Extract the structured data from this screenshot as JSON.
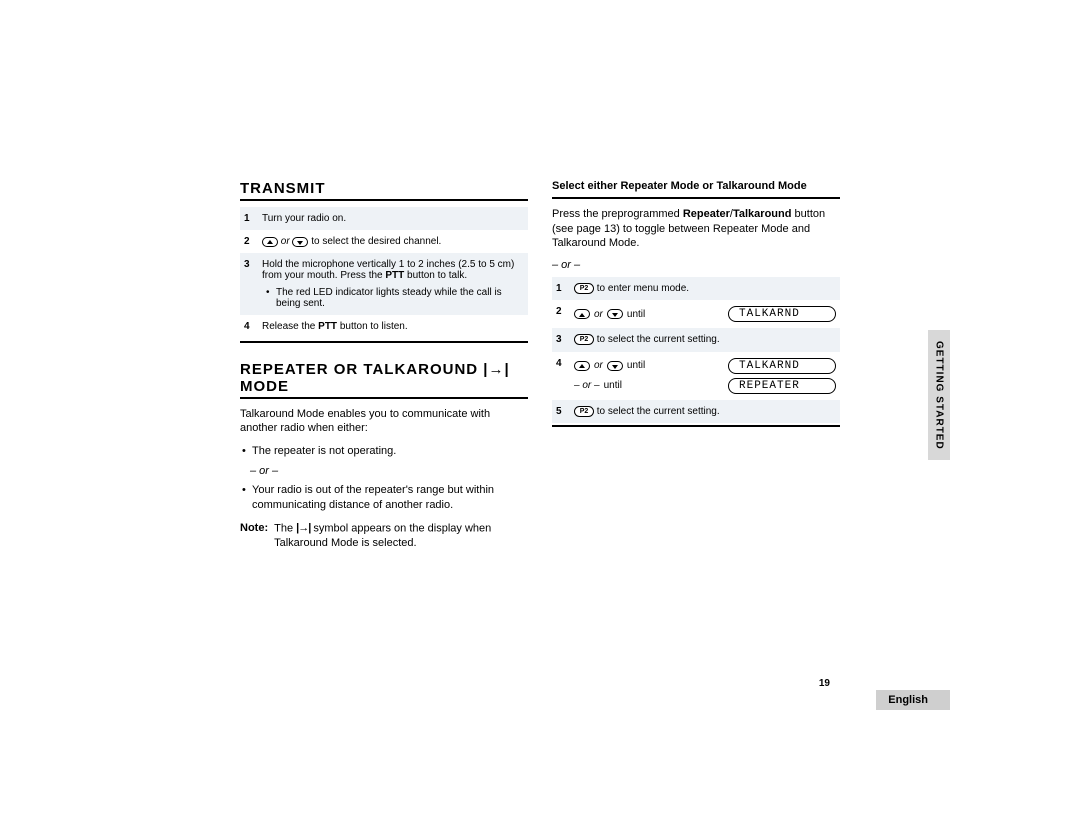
{
  "page_number": "19",
  "side_tab": "GETTING STARTED",
  "language": "English",
  "left_col": {
    "h_transmit": "TRANSMIT",
    "transmit_steps": {
      "s1": "Turn your radio on.",
      "s2_prefix": " ",
      "s2_or": "or",
      "s2_suffix": " to select the desired channel.",
      "s3a": "Hold the microphone vertically 1 to 2 inches (2.5 to 5 cm) from your mouth. Press the ",
      "s3b": "PTT",
      "s3c": " button to talk.",
      "s3_bullet": "The red LED indicator lights steady while the call is being sent.",
      "s4a": "Release the ",
      "s4b": "PTT",
      "s4c": " button to listen."
    },
    "h_repeater": "REPEATER OR TALKAROUND |→| MODE",
    "body1": "Talkaround Mode enables you to communicate with another radio when either:",
    "bullet1": "The repeater is not operating.",
    "or": "– or –",
    "bullet2": "Your radio is out of the repeater's range but within communicating distance of another radio.",
    "note_label": "Note:",
    "note_a": "The ",
    "note_b": " symbol appears on the display when Talkaround Mode is selected."
  },
  "right_col": {
    "sub_head": "Select either Repeater Mode or Talkaround Mode",
    "para_a": "Press the preprogrammed ",
    "para_b": "Repeater",
    "para_c": "/",
    "para_d": "Talkaround",
    "para_e": " button (see page 13) to toggle between Repeater Mode and Talkaround Mode.",
    "or": "– or –",
    "steps": {
      "p2_label": "P2",
      "s1": " to enter menu mode.",
      "s2_or": "or",
      "s2_until": " until",
      "disp_talkarnd": "TALKARND",
      "s3": " to select the current setting.",
      "s4_or": "or",
      "s4_until": " until",
      "s4_or_until": "– or – ",
      "s4_or_until_b": "until",
      "disp_repeater": "REPEATER",
      "s5": " to select the current setting."
    }
  },
  "talkaround_symbol": "|→|"
}
